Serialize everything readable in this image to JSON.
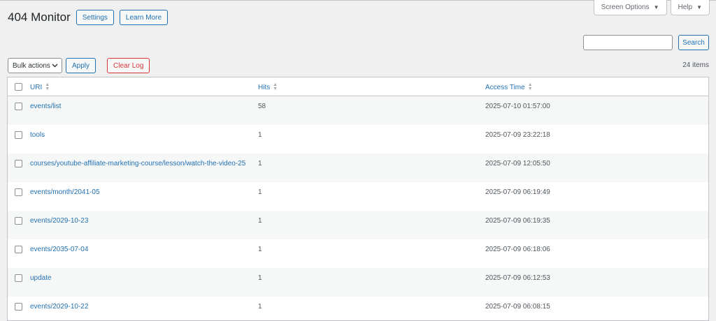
{
  "page": {
    "title": "404 Monitor",
    "settings_label": "Settings",
    "learn_more_label": "Learn More"
  },
  "screen_meta": {
    "screen_options_label": "Screen Options",
    "help_label": "Help",
    "arrow": "▼"
  },
  "search": {
    "value": "",
    "button_label": "Search"
  },
  "tablenav": {
    "bulk_actions_label": "Bulk actions",
    "apply_label": "Apply",
    "clear_log_label": "Clear Log",
    "items_count": "24 items"
  },
  "table": {
    "headers": {
      "uri": "URI",
      "hits": "Hits",
      "access_time": "Access Time"
    },
    "rows": [
      {
        "uri": "events/list",
        "hits": "58",
        "time": "2025-07-10 01:57:00"
      },
      {
        "uri": "tools",
        "hits": "1",
        "time": "2025-07-09 23:22:18"
      },
      {
        "uri": "courses/youtube-affiliate-marketing-course/lesson/watch-the-video-25",
        "hits": "1",
        "time": "2025-07-09 12:05:50"
      },
      {
        "uri": "events/month/2041-05",
        "hits": "1",
        "time": "2025-07-09 06:19:49"
      },
      {
        "uri": "events/2029-10-23",
        "hits": "1",
        "time": "2025-07-09 06:19:35"
      },
      {
        "uri": "events/2035-07-04",
        "hits": "1",
        "time": "2025-07-09 06:18:06"
      },
      {
        "uri": "update",
        "hits": "1",
        "time": "2025-07-09 06:12:53"
      },
      {
        "uri": "events/2029-10-22",
        "hits": "1",
        "time": "2025-07-09 06:08:15"
      }
    ]
  },
  "colors": {
    "accent": "#2271b1",
    "danger": "#d63638",
    "background": "#f0f0f1"
  }
}
